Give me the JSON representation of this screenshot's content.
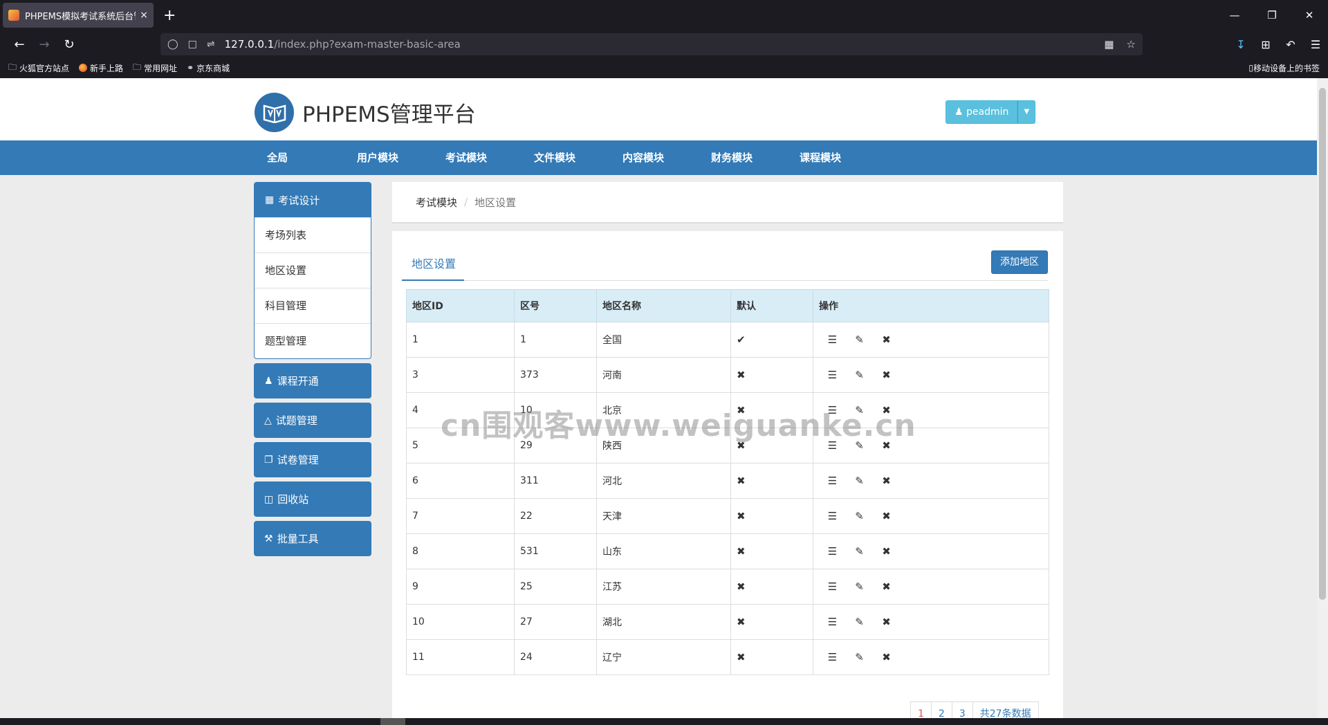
{
  "browser": {
    "tab_title": "PHPEMS模拟考试系统后台管理",
    "tab_close": "×",
    "new_tab": "+",
    "url_host": "127.0.0.1",
    "url_path": "/index.php?exam-master-basic-area",
    "bookmarks": [
      "火狐官方站点",
      "新手上路",
      "常用网址",
      "京东商城"
    ],
    "mobile_bookmarks": "移动设备上的书签"
  },
  "header": {
    "logo_text": "PHPEMS管理平台",
    "user_label": "peadmin"
  },
  "main_nav": [
    "全局",
    "用户模块",
    "考试模块",
    "文件模块",
    "内容模块",
    "财务模块",
    "课程模块"
  ],
  "sidebar": {
    "section_title": "考试设计",
    "items": [
      "考场列表",
      "地区设置",
      "科目管理",
      "题型管理"
    ],
    "buttons": [
      {
        "label": "课程开通",
        "icon": "user-icon"
      },
      {
        "label": "试题管理",
        "icon": "text-icon"
      },
      {
        "label": "试卷管理",
        "icon": "copy-icon"
      },
      {
        "label": "回收站",
        "icon": "trash-icon"
      },
      {
        "label": "批量工具",
        "icon": "wrench-icon"
      }
    ]
  },
  "breadcrumb": {
    "module": "考试模块",
    "current": "地区设置"
  },
  "content": {
    "tab_label": "地区设置",
    "add_button": "添加地区",
    "columns": [
      "地区ID",
      "区号",
      "地区名称",
      "默认",
      "操作"
    ],
    "rows": [
      {
        "id": "1",
        "code": "1",
        "name": "全国",
        "default": true
      },
      {
        "id": "3",
        "code": "373",
        "name": "河南",
        "default": false
      },
      {
        "id": "4",
        "code": "10",
        "name": "北京",
        "default": false
      },
      {
        "id": "5",
        "code": "29",
        "name": "陕西",
        "default": false
      },
      {
        "id": "6",
        "code": "311",
        "name": "河北",
        "default": false
      },
      {
        "id": "7",
        "code": "22",
        "name": "天津",
        "default": false
      },
      {
        "id": "8",
        "code": "531",
        "name": "山东",
        "default": false
      },
      {
        "id": "9",
        "code": "25",
        "name": "江苏",
        "default": false
      },
      {
        "id": "10",
        "code": "27",
        "name": "湖北",
        "default": false
      },
      {
        "id": "11",
        "code": "24",
        "name": "辽宁",
        "default": false
      }
    ],
    "pagination": {
      "pages": [
        "1",
        "2",
        "3"
      ],
      "active": "1",
      "total": "共27条数据"
    }
  },
  "watermark": "cn围观客www.weiguanke.cn"
}
